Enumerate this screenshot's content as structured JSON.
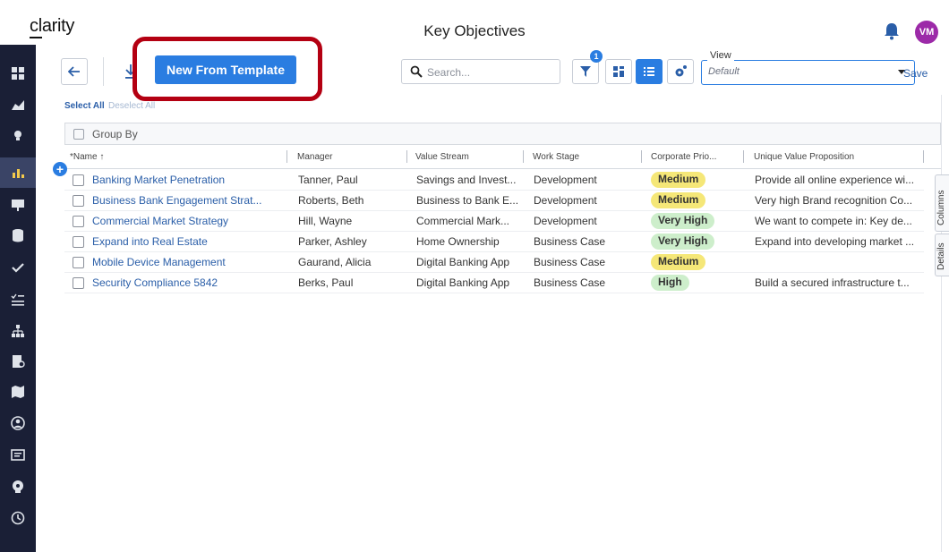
{
  "header": {
    "logo": "clarity",
    "title": "Key Objectives",
    "avatar_initials": "VM"
  },
  "toolbar": {
    "new_from_template_label": "New From Template",
    "search_placeholder": "Search...",
    "filter_count": "1",
    "view_legend": "View",
    "view_value": "Default",
    "save_label": "Save"
  },
  "selection": {
    "select_all": "Select All",
    "deselect_all": "Deselect All"
  },
  "group_by_label": "Group By",
  "columns": [
    "*Name ↑",
    "Manager",
    "Value Stream",
    "Work Stage",
    "Corporate Prio...",
    "Unique Value Proposition"
  ],
  "rows": [
    {
      "name": "Banking Market Penetration",
      "manager": "Tanner, Paul",
      "value_stream": "Savings and Invest...",
      "work_stage": "Development",
      "priority": "Medium",
      "uvp": "Provide all online experience wi..."
    },
    {
      "name": "Business Bank Engagement Strat...",
      "manager": "Roberts, Beth",
      "value_stream": "Business to Bank E...",
      "work_stage": "Development",
      "priority": "Medium",
      "uvp": "Very high Brand recognition Co..."
    },
    {
      "name": "Commercial Market Strategy",
      "manager": "Hill, Wayne",
      "value_stream": "Commercial Mark...",
      "work_stage": "Development",
      "priority": "Very High",
      "uvp": "We want to compete in: Key de..."
    },
    {
      "name": "Expand into Real Estate",
      "manager": "Parker, Ashley",
      "value_stream": "Home Ownership",
      "work_stage": "Business Case",
      "priority": "Very High",
      "uvp": "Expand into developing market ..."
    },
    {
      "name": "Mobile Device Management",
      "manager": "Gaurand, Alicia",
      "value_stream": "Digital Banking App",
      "work_stage": "Business Case",
      "priority": "Medium",
      "uvp": ""
    },
    {
      "name": "Security Compliance 5842",
      "manager": "Berks, Paul",
      "value_stream": "Digital Banking App",
      "work_stage": "Business Case",
      "priority": "High",
      "uvp": "Build a secured infrastructure t..."
    }
  ],
  "side_tabs": {
    "columns": "Columns",
    "details": "Details"
  },
  "colors": {
    "accent": "#2a7de1",
    "sidebar": "#1a1f36",
    "highlight": "#b40012",
    "medium": "#f5e778",
    "high": "#cdeecb"
  },
  "sidebar_icons": [
    "grid-icon",
    "chart-area-icon",
    "lightbulb-icon",
    "bar-chart-icon",
    "presentation-icon",
    "database-icon",
    "check-icon",
    "checklist-icon",
    "hierarchy-icon",
    "document-icon",
    "map-icon",
    "team-icon",
    "report-icon",
    "brain-icon",
    "clock-icon"
  ]
}
